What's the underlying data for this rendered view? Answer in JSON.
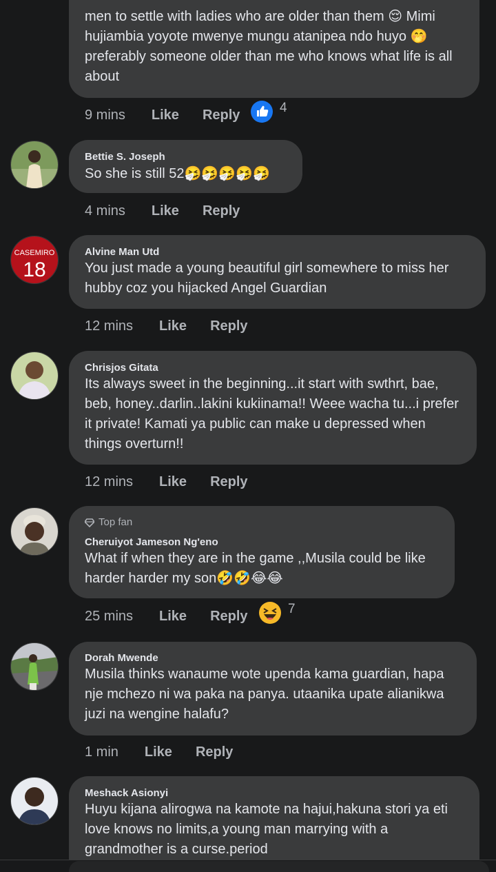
{
  "comments": [
    {
      "text": "men to settle with ladies who are older than them 😌 Mimi hujiambia yoyote mwenye mungu atanipea ndo huyo 🤭 preferably someone older than me who knows what life is all about",
      "time": "9 mins",
      "like": "Like",
      "reply": "Reply",
      "reaction_icon": "thumbs-up-icon",
      "reaction_count": "4"
    },
    {
      "author": "Bettie S. Joseph",
      "text": "So she is still 52🤧🤧🤧🤧🤧",
      "time": "4 mins",
      "like": "Like",
      "reply": "Reply"
    },
    {
      "author": "Alvine Man Utd",
      "avatar_text": "CASEMIRO",
      "avatar_number": "18",
      "text": "You just made a young beautiful girl somewhere to miss her hubby coz you  hijacked Angel Guardian",
      "time": "12 mins",
      "like": "Like",
      "reply": "Reply"
    },
    {
      "author": "Chrisjos Gitata",
      "text": "Its always sweet in the beginning...it start with swthrt, bae, beb, honey..darlin..lakini kukiinama!! Weee wacha tu...i prefer it private! Kamati ya public can make u depressed when things overturn!!",
      "time": "12 mins",
      "like": "Like",
      "reply": "Reply"
    },
    {
      "badge": "Top fan",
      "author": "Cheruiyot Jameson Ng'eno",
      "text": "What if when they are in the game ,,Musila could be like harder harder my son🤣🤣😂😂",
      "time": "25 mins",
      "like": "Like",
      "reply": "Reply",
      "reaction_icon": "laughing-face-icon",
      "reaction_count": "7"
    },
    {
      "author": "Dorah Mwende",
      "text": "Musila thinks wanaume wote upenda kama guardian, hapa nje mchezo ni wa paka na panya. utaanika upate alianikwa juzi na wengine halafu?",
      "time": "1 min",
      "like": "Like",
      "reply": "Reply"
    },
    {
      "author": "Meshack Asionyi",
      "text": "Huyu kijana alirogwa na kamote na hajui,hakuna stori ya eti love knows no limits,a young man marrying with a grandmother is a curse.period"
    }
  ],
  "colors": {
    "background": "#18191a",
    "bubble": "#3a3b3c",
    "text": "#e4e6eb",
    "muted": "#b0b3b8",
    "like_blue": "#1877f2"
  }
}
